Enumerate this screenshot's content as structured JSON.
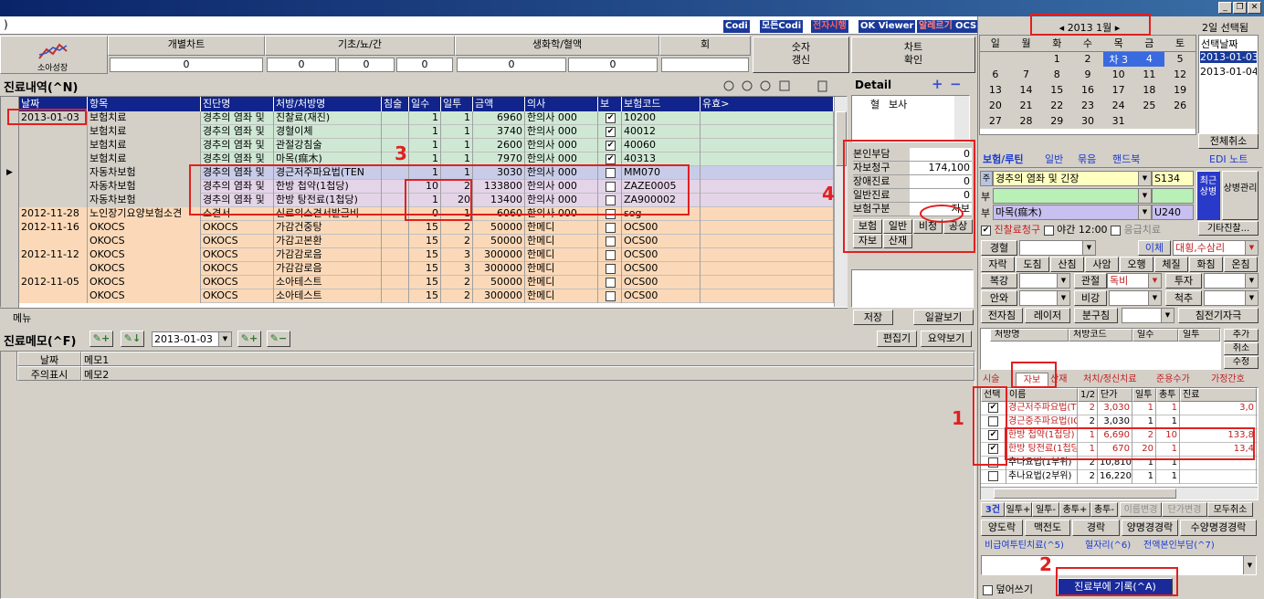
{
  "window": {
    "title_left": ")"
  },
  "toolbar_badges": [
    "Codi",
    "모든Codi",
    "전자시행",
    "OK Viewer",
    "알레르기",
    "OCS"
  ],
  "chart_header": {
    "logo_label": "소아성장",
    "headers": [
      "개별차트",
      "기초/뇨/간",
      "생화학/혈액",
      "회"
    ],
    "values": [
      "0",
      "0",
      "0",
      "0",
      "0",
      "0"
    ],
    "btn_refresh": "숫자\n갱신",
    "btn_confirm": "차트\n확인"
  },
  "treatment": {
    "title": "진료내역(^N)",
    "columns": [
      "날짜",
      "항목",
      "진단명",
      "처방/처방명",
      "침술",
      "일수",
      "일투",
      "금액",
      "의사",
      "보",
      "보험코드",
      "유효>"
    ],
    "rows": [
      {
        "date": "2013-01-03",
        "item": "보험치료",
        "diag": "경추의 염좌 및",
        "rx": "진찰료(재진)",
        "ch": "",
        "days": "1",
        "daily": "1",
        "amt": "6960",
        "doc": "한의사 000",
        "chk": true,
        "code": "10200",
        "bg": "#cfe8d4"
      },
      {
        "date": "",
        "item": "보험치료",
        "diag": "경추의 염좌 및",
        "rx": "경혈이체",
        "ch": "",
        "days": "1",
        "daily": "1",
        "amt": "3740",
        "doc": "한의사 000",
        "chk": true,
        "code": "40012",
        "bg": "#cfe8d4"
      },
      {
        "date": "",
        "item": "보험치료",
        "diag": "경추의 염좌 및",
        "rx": "관절강침술",
        "ch": "",
        "days": "1",
        "daily": "1",
        "amt": "2600",
        "doc": "한의사 000",
        "chk": true,
        "code": "40060",
        "bg": "#cfe8d4"
      },
      {
        "date": "",
        "item": "보험치료",
        "diag": "경추의 염좌 및",
        "rx": "마목(痲木)",
        "ch": "",
        "days": "1",
        "daily": "1",
        "amt": "7970",
        "doc": "한의사 000",
        "chk": true,
        "code": "40313",
        "bg": "#cfe8d4"
      },
      {
        "date": "",
        "item": "자동차보험",
        "diag": "경추의 염좌 및",
        "rx": "경근저주파요법(TEN",
        "ch": "",
        "days": "1",
        "daily": "1",
        "amt": "3030",
        "doc": "한의사 000",
        "chk": false,
        "code": "MM070",
        "bg": "#c9cce8"
      },
      {
        "date": "",
        "item": "자동차보험",
        "diag": "경추의 염좌 및",
        "rx": "한방 첩약(1첩당)",
        "ch": "",
        "days": "10",
        "daily": "2",
        "amt": "133800",
        "doc": "한의사 000",
        "chk": false,
        "code": "ZAZE0005",
        "bg": "#e4d4e8"
      },
      {
        "date": "",
        "item": "자동차보험",
        "diag": "경추의 염좌 및",
        "rx": "한방 탕전료(1첩당)",
        "ch": "",
        "days": "1",
        "daily": "20",
        "amt": "13400",
        "doc": "한의사 000",
        "chk": false,
        "code": "ZA900002",
        "bg": "#e4d4e8"
      },
      {
        "date": "2012-11-28",
        "item": "노인장기요양보험소견",
        "diag": "소견서",
        "rx": "신료의소견서발급비",
        "ch": "",
        "days": "0",
        "daily": "1",
        "amt": "6060",
        "doc": "한의사 000",
        "chk": false,
        "code": "sog",
        "bg": "#fbd9b8"
      },
      {
        "date": "2012-11-16",
        "item": "OKOCS",
        "diag": "OKOCS",
        "rx": "가감건중탕",
        "ch": "",
        "days": "15",
        "daily": "2",
        "amt": "50000",
        "doc": "한메디",
        "chk": false,
        "code": "OCS00",
        "bg": "#fbd9b8"
      },
      {
        "date": "",
        "item": "OKOCS",
        "diag": "OKOCS",
        "rx": "가감고본환",
        "ch": "",
        "days": "15",
        "daily": "2",
        "amt": "50000",
        "doc": "한메디",
        "chk": false,
        "code": "OCS00",
        "bg": "#fbd9b8"
      },
      {
        "date": "2012-11-12",
        "item": "OKOCS",
        "diag": "OKOCS",
        "rx": "가감감로음",
        "ch": "",
        "days": "15",
        "daily": "3",
        "amt": "300000",
        "doc": "한메디",
        "chk": false,
        "code": "OCS00",
        "bg": "#fbd9b8"
      },
      {
        "date": "",
        "item": "OKOCS",
        "diag": "OKOCS",
        "rx": "가감감로음",
        "ch": "",
        "days": "15",
        "daily": "3",
        "amt": "300000",
        "doc": "한메디",
        "chk": false,
        "code": "OCS00",
        "bg": "#fbd9b8"
      },
      {
        "date": "2012-11-05",
        "item": "OKOCS",
        "diag": "OKOCS",
        "rx": "소아테스트",
        "ch": "",
        "days": "15",
        "daily": "2",
        "amt": "50000",
        "doc": "한메디",
        "chk": false,
        "code": "OCS00",
        "bg": "#fbd9b8"
      },
      {
        "date": "",
        "item": "OKOCS",
        "diag": "OKOCS",
        "rx": "소아테스트",
        "ch": "",
        "days": "15",
        "daily": "2",
        "amt": "300000",
        "doc": "한메디",
        "chk": false,
        "code": "OCS00",
        "bg": "#fbd9b8"
      }
    ],
    "menu_label": "메뉴"
  },
  "detail": {
    "title": "Detail",
    "col1": "혈",
    "col2": "보사",
    "fields": [
      [
        "본인부담",
        "0"
      ],
      [
        "자보청구",
        "174,100"
      ],
      [
        "장애진료",
        "0"
      ],
      [
        "일반진료",
        "0"
      ],
      [
        "보험구분",
        "자보"
      ]
    ],
    "tabs": [
      "보험",
      "일반",
      "비청",
      "공상",
      "자보",
      "산재"
    ],
    "btn_save": "저장",
    "btn_view": "일괄보기"
  },
  "memo": {
    "title": "진료메모(^F)",
    "date": "2013-01-03",
    "btn_edit": "편집기",
    "btn_summary": "요약보기",
    "col_date": "날짜",
    "col_memo1": "메모1",
    "col_mark": "주의표시",
    "col_memo2": "메모2"
  },
  "calendar": {
    "month_label": "2013  1월",
    "selected_count": "2일 선택됨",
    "weekdays": [
      "일",
      "월",
      "화",
      "수",
      "목",
      "금",
      "토"
    ],
    "weeks": [
      [
        "",
        "",
        "1",
        "2",
        "차 3",
        "4",
        "5"
      ],
      [
        "6",
        "7",
        "8",
        "9",
        "10",
        "11",
        "12"
      ],
      [
        "13",
        "14",
        "15",
        "16",
        "17",
        "18",
        "19"
      ],
      [
        "20",
        "21",
        "22",
        "23",
        "24",
        "25",
        "26"
      ],
      [
        "27",
        "28",
        "29",
        "30",
        "31",
        "",
        ""
      ]
    ],
    "sel_header": "선택날짜",
    "sel_dates": [
      "2013-01-03",
      "2013-01-04"
    ],
    "btn_cancel_all": "전체취소"
  },
  "right_tabs": {
    "items": [
      "보험/루틴",
      "일반",
      "묶음",
      "핸드북"
    ],
    "edi": "EDI 노트"
  },
  "diagnosis": {
    "main_label": "경추의 염좌 및 긴장",
    "main_code": "S134",
    "sub1_label": "부",
    "sub2_label": "부",
    "sub2_value": "마목(痲木)",
    "sub2_code": "U240",
    "btn_recent": "최근상병",
    "btn_manage": "상병관리",
    "chk_claim": "진찰료청구",
    "chk_night": "야간",
    "time": "12:00",
    "chk_emergency": "응급치료",
    "btn_other": "기타진찰..."
  },
  "acu": {
    "label_gyeonghyeol": "경혈",
    "label_eche": "이체",
    "eche_value": "대횡,수삼리",
    "row2": [
      "자락",
      "도침",
      "산침",
      "사암",
      "오행",
      "체질",
      "화침",
      "온침"
    ],
    "label_bokgang": "복강",
    "label_gwanjeol": "관절",
    "gwanjeol_value": "독비",
    "label_tuja": "투자",
    "label_anwa": "안와",
    "label_bigang": "비강",
    "label_cheokju": "척추",
    "row5": [
      "전자침",
      "레이저",
      "분구침",
      "침전기자극"
    ]
  },
  "rx_table": {
    "cols": [
      "처방명",
      "처방코드",
      "일수",
      "일투"
    ],
    "btns": [
      "추가",
      "취소",
      "수정"
    ]
  },
  "fee": {
    "tabs": [
      "시술",
      "자보",
      "산재",
      "처치/정신치료",
      "준용수가",
      "가정간호"
    ],
    "columns": [
      "선택",
      "이름",
      "1/2",
      "단가",
      "일투",
      "총투",
      "진료"
    ],
    "rows": [
      {
        "chk": true,
        "name": "경근저주파요법(TEN",
        "half": "2",
        "price": "3,030",
        "daily": "1",
        "total": "1",
        "fee": "3,0"
      },
      {
        "chk": false,
        "name": "경근중주파요법(ICT",
        "half": "2",
        "price": "3,030",
        "daily": "1",
        "total": "1",
        "fee": ""
      },
      {
        "chk": true,
        "name": "한방 첩약(1첩당)",
        "half": "1",
        "price": "6,690",
        "daily": "2",
        "total": "10",
        "fee": "133,8"
      },
      {
        "chk": true,
        "name": "한방 탕전료(1첩당)",
        "half": "1",
        "price": "670",
        "daily": "20",
        "total": "1",
        "fee": "13,4"
      },
      {
        "chk": false,
        "name": "추나요법(1부위)",
        "half": "2",
        "price": "10,810",
        "daily": "1",
        "total": "1",
        "fee": ""
      },
      {
        "chk": false,
        "name": "추나요법(2부위)",
        "half": "2",
        "price": "16,220",
        "daily": "1",
        "total": "1",
        "fee": ""
      }
    ],
    "bottom": [
      "3건",
      "일투+",
      "일투-",
      "총투+",
      "총투-",
      "이름변경",
      "단가변경",
      "모두취소"
    ],
    "lower_btns": [
      "양도락",
      "맥전도",
      "경락",
      "양명경경락",
      "수양명경경락"
    ],
    "lower_tabs": [
      "비급여투틴치료(^5)",
      "혈자리(^6)",
      "전액본인부담(^7)"
    ],
    "overwrite": "덮어쓰기",
    "record": "진료부에 기록(^A)"
  },
  "annotations": [
    "1",
    "2",
    "3",
    "4"
  ]
}
